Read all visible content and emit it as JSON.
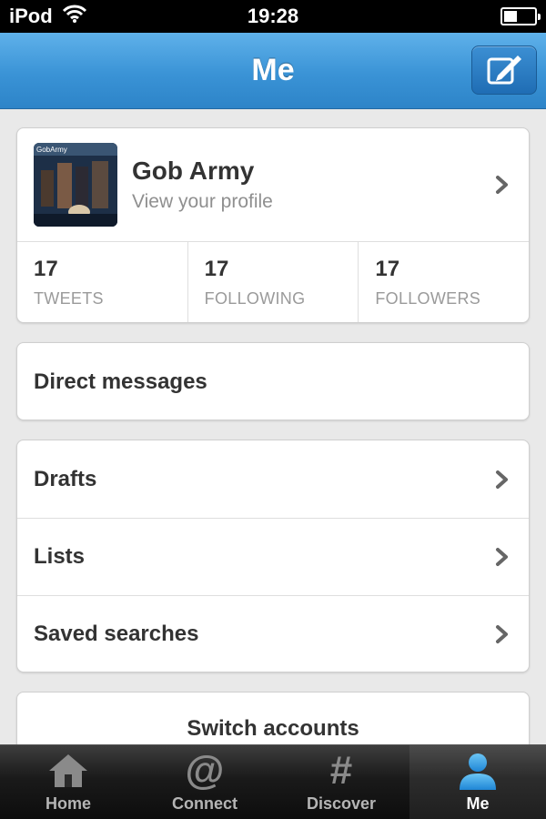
{
  "status_bar": {
    "carrier": "iPod",
    "time": "19:28",
    "battery_level": 0.45
  },
  "nav": {
    "title": "Me",
    "compose_icon": "compose-icon"
  },
  "profile": {
    "name": "Gob Army",
    "subtitle": "View your profile",
    "avatar_caption": "GobArmy",
    "stats": [
      {
        "count": "17",
        "label": "TWEETS"
      },
      {
        "count": "17",
        "label": "FOLLOWING"
      },
      {
        "count": "17",
        "label": "FOLLOWERS"
      }
    ]
  },
  "direct_messages": {
    "label": "Direct messages"
  },
  "menu": [
    {
      "label": "Drafts"
    },
    {
      "label": "Lists"
    },
    {
      "label": "Saved searches"
    }
  ],
  "switch_accounts": {
    "label": "Switch accounts"
  },
  "tabs": [
    {
      "label": "Home",
      "icon": "home-icon",
      "active": false
    },
    {
      "label": "Connect",
      "icon": "at-icon",
      "active": false
    },
    {
      "label": "Discover",
      "icon": "hash-icon",
      "active": false
    },
    {
      "label": "Me",
      "icon": "person-icon",
      "active": true
    }
  ],
  "colors": {
    "nav_blue": "#3a93d6",
    "active_tab_icon": "#3aa3e8",
    "text_dark": "#333333",
    "text_muted": "#8f8f8f"
  }
}
